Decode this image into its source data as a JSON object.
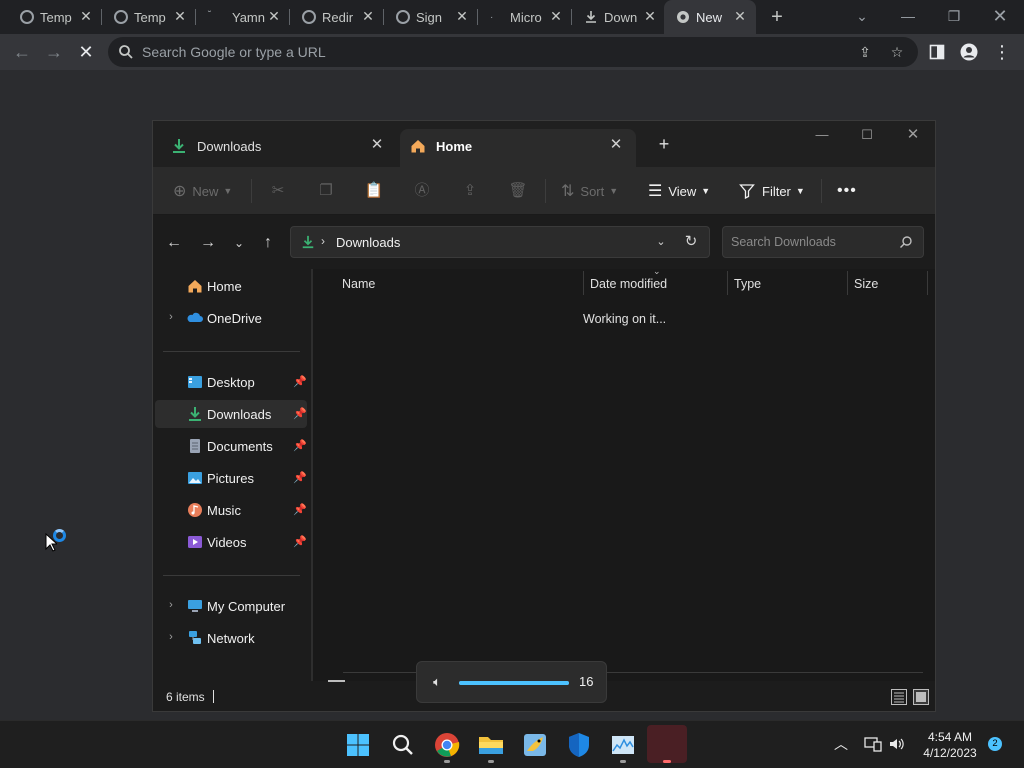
{
  "browser": {
    "tabs": [
      {
        "title": "Temp",
        "icon": "globe-icon",
        "active": false
      },
      {
        "title": "Temp",
        "icon": "globe-icon",
        "active": false
      },
      {
        "title": "Yamn",
        "icon": "loading-icon",
        "active": false
      },
      {
        "title": "Redir",
        "icon": "globe-icon",
        "active": false
      },
      {
        "title": "Sign",
        "icon": "globe-icon",
        "active": false
      },
      {
        "title": "Micro",
        "icon": "loading-icon",
        "active": false
      },
      {
        "title": "Down",
        "icon": "download-icon",
        "active": false
      },
      {
        "title": "New",
        "icon": "chrome-icon",
        "active": true
      }
    ],
    "omnibox_placeholder": "Search Google or type a URL"
  },
  "explorer": {
    "tabs": [
      {
        "title": "Downloads",
        "icon": "downloads-icon",
        "active": false
      },
      {
        "title": "Home",
        "icon": "home-icon",
        "active": true
      }
    ],
    "commands": {
      "new_label": "New",
      "sort_label": "Sort",
      "view_label": "View",
      "filter_label": "Filter"
    },
    "address_path": "Downloads",
    "search_placeholder": "Search Downloads",
    "sidebar": {
      "top": [
        {
          "label": "Home",
          "icon": "home-icon",
          "expandable": false
        },
        {
          "label": "OneDrive",
          "icon": "onedrive-icon",
          "expandable": true
        }
      ],
      "pinned": [
        {
          "label": "Desktop",
          "icon": "desktop-icon",
          "selected": false
        },
        {
          "label": "Downloads",
          "icon": "downloads-icon",
          "selected": true
        },
        {
          "label": "Documents",
          "icon": "documents-icon",
          "selected": false
        },
        {
          "label": "Pictures",
          "icon": "pictures-icon",
          "selected": false
        },
        {
          "label": "Music",
          "icon": "music-icon",
          "selected": false
        },
        {
          "label": "Videos",
          "icon": "videos-icon",
          "selected": false
        }
      ],
      "bottom": [
        {
          "label": "My Computer",
          "icon": "computer-icon",
          "expandable": true
        },
        {
          "label": "Network",
          "icon": "network-icon",
          "expandable": true
        }
      ]
    },
    "columns": [
      "Name",
      "Date modified",
      "Type",
      "Size"
    ],
    "status_message": "Working on it...",
    "item_count": "6 items"
  },
  "volume": {
    "level": 16
  },
  "taskbar": {
    "apps": [
      "start-icon",
      "search-icon",
      "chrome-icon",
      "file-explorer-icon",
      "wireshark-icon",
      "defender-icon",
      "task-manager-icon",
      "app-icon"
    ],
    "time": "4:54 AM",
    "date": "4/12/2023",
    "notification_count": "2"
  },
  "colors": {
    "accent": "#4cc2ff",
    "download_green": "#3bb273",
    "folder_yellow": "#f3c23c"
  }
}
